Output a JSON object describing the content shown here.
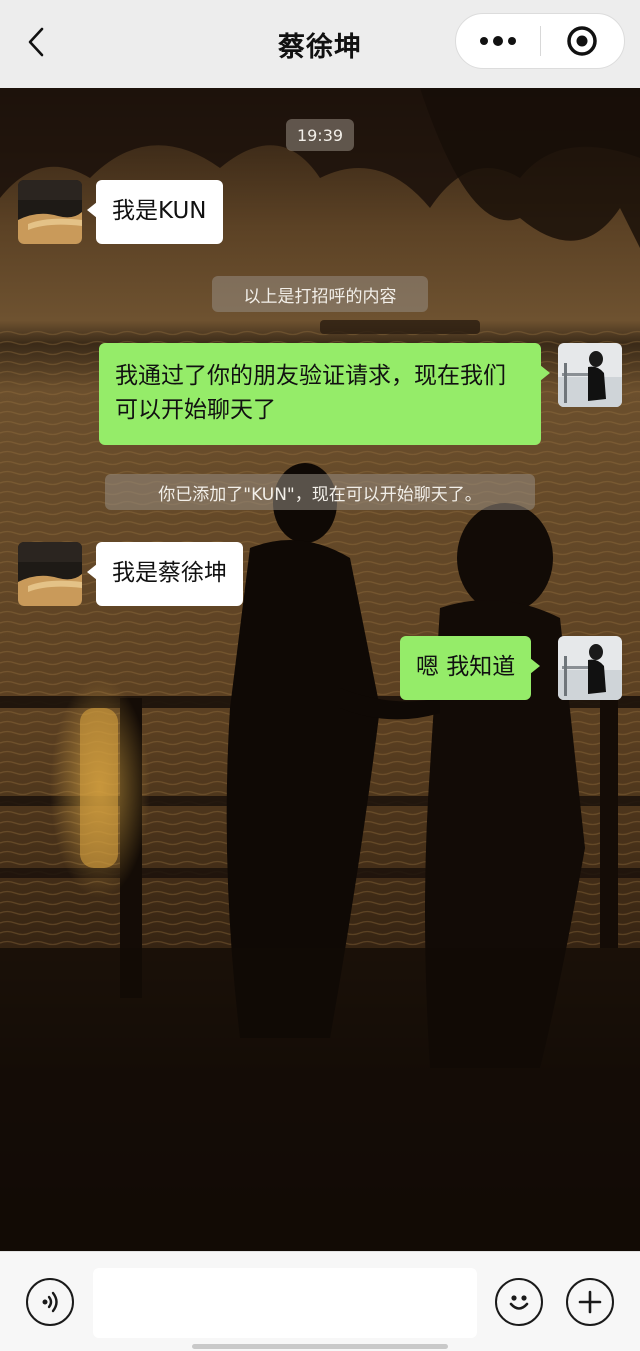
{
  "header": {
    "title": "蔡徐坤",
    "back_icon": "chevron-left-icon",
    "menu_icon": "more-dots-icon",
    "close_icon": "target-close-icon"
  },
  "chat": {
    "time": "19:39",
    "messages": [
      {
        "side": "left",
        "text": "我是KUN",
        "avatar": "desert-avatar"
      },
      {
        "type": "system",
        "text": "以上是打招呼的内容"
      },
      {
        "side": "right",
        "text": "我通过了你的朋友验证请求，现在我们可以开始聊天了",
        "avatar": "girl-avatar"
      },
      {
        "type": "system",
        "text": "你已添加了\"KUN\"，现在可以开始聊天了。"
      },
      {
        "side": "left",
        "text": "我是蔡徐坤",
        "avatar": "desert-avatar"
      },
      {
        "side": "right",
        "text": "嗯 我知道",
        "avatar": "girl-avatar"
      }
    ]
  },
  "input_bar": {
    "input_value": "",
    "voice_icon": "voice-icon",
    "emoji_icon": "emoji-icon",
    "plus_icon": "plus-icon"
  },
  "colors": {
    "bar_bg": "#ededed",
    "sent_bubble": "#95ec69",
    "received_bubble": "#ffffff"
  }
}
